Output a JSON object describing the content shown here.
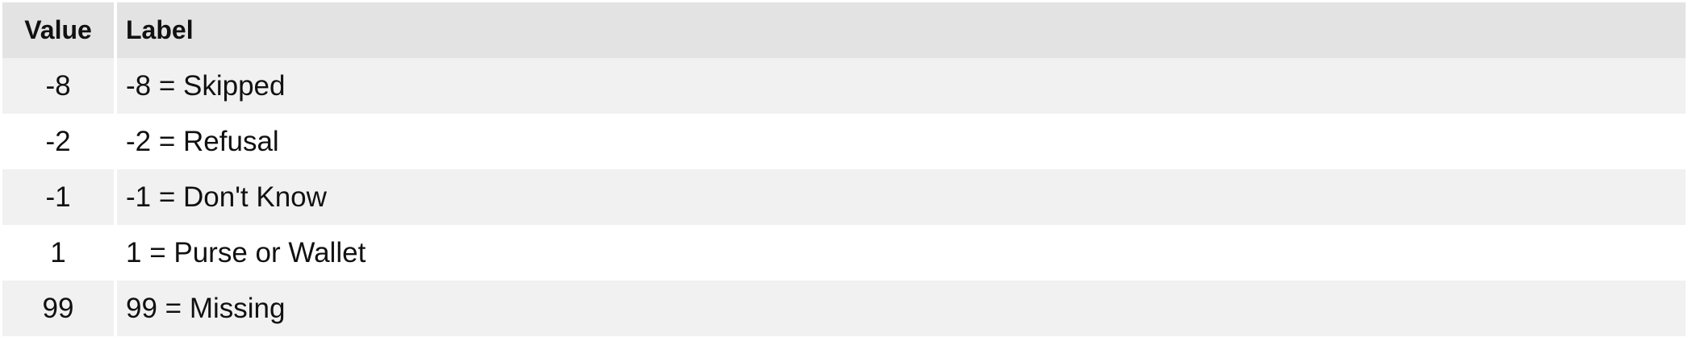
{
  "table": {
    "headers": {
      "value": "Value",
      "label": "Label"
    },
    "rows": [
      {
        "value": "-8",
        "label": "-8 = Skipped"
      },
      {
        "value": "-2",
        "label": "-2 = Refusal"
      },
      {
        "value": "-1",
        "label": "-1 = Don't Know"
      },
      {
        "value": "1",
        "label": "1 = Purse or Wallet"
      },
      {
        "value": "99",
        "label": "99 = Missing"
      }
    ]
  }
}
